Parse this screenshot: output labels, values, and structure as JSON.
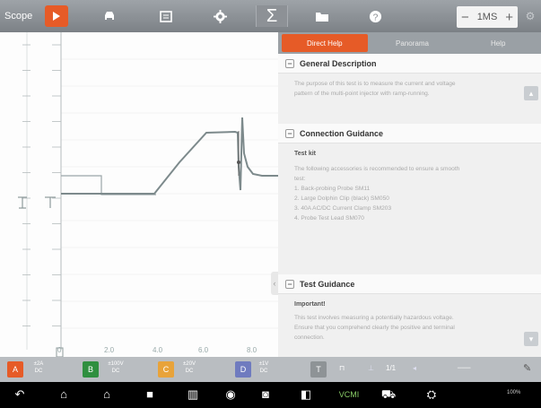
{
  "app_title": "Scope",
  "toolbar": {
    "run_icon": "play-icon",
    "icons": [
      "car-icon",
      "document-icon",
      "gear-icon",
      "sigma-icon",
      "folder-icon",
      "help-icon"
    ],
    "timebase": "1MS",
    "minus": "−",
    "plus": "+",
    "settings_icon": "settings-icon"
  },
  "scope": {
    "x_ticks": [
      "0",
      "2.0",
      "4.0",
      "6.0",
      "8.0"
    ],
    "y_ticks": [
      "",
      "",
      "",
      "",
      "",
      "",
      "",
      "",
      "",
      "",
      "",
      "",
      ""
    ],
    "trace_color": "#7d8a8c",
    "marker_color": "#9aa6a8"
  },
  "panel": {
    "tabs": [
      "Direct Help",
      "Panorama",
      "Help"
    ],
    "sections": [
      {
        "title": "General Description",
        "lines": [
          "The purpose of this test is to measure the current and voltage",
          "pattern of the multi-point injector with ramp-running."
        ]
      },
      {
        "title": "Connection Guidance",
        "subtitle": "Test kit",
        "lines": [
          "The following accessories is recommended to ensure a smooth",
          "test:",
          "1. Back-probing Probe SM11",
          "2. Large Dolphin Clip (black) SM050",
          "3. 40A AC/DC Current Clamp SM203",
          "4. Probe Test Lead SM070"
        ]
      },
      {
        "title": "Test Guidance",
        "subtitle": "Important!",
        "lines": [
          "This test involves measuring a potentially hazardous voltage.",
          "Ensure that you comprehend clearly the positive and terminal",
          "connection."
        ]
      }
    ]
  },
  "channels": [
    {
      "letter": "A",
      "color": "#e65b27",
      "range": "±2A",
      "coupling": "DC"
    },
    {
      "letter": "B",
      "color": "#2f8f3f",
      "range": "±100V",
      "coupling": "DC"
    },
    {
      "letter": "C",
      "color": "#e8a33a",
      "range": "±20V",
      "coupling": "DC"
    },
    {
      "letter": "D",
      "color": "#6f7bbf",
      "range": "±1V",
      "coupling": "DC"
    }
  ],
  "controls": {
    "trigger": "T",
    "edge": "⊓",
    "ratio": "1/1"
  },
  "nav": [
    "back-icon",
    "home-icon",
    "house-icon",
    "stop-icon",
    "window-icon",
    "vci-icon",
    "camera-icon",
    "screen-icon",
    "VCMI",
    "car-icon",
    "network-icon"
  ],
  "status_text": "100%"
}
